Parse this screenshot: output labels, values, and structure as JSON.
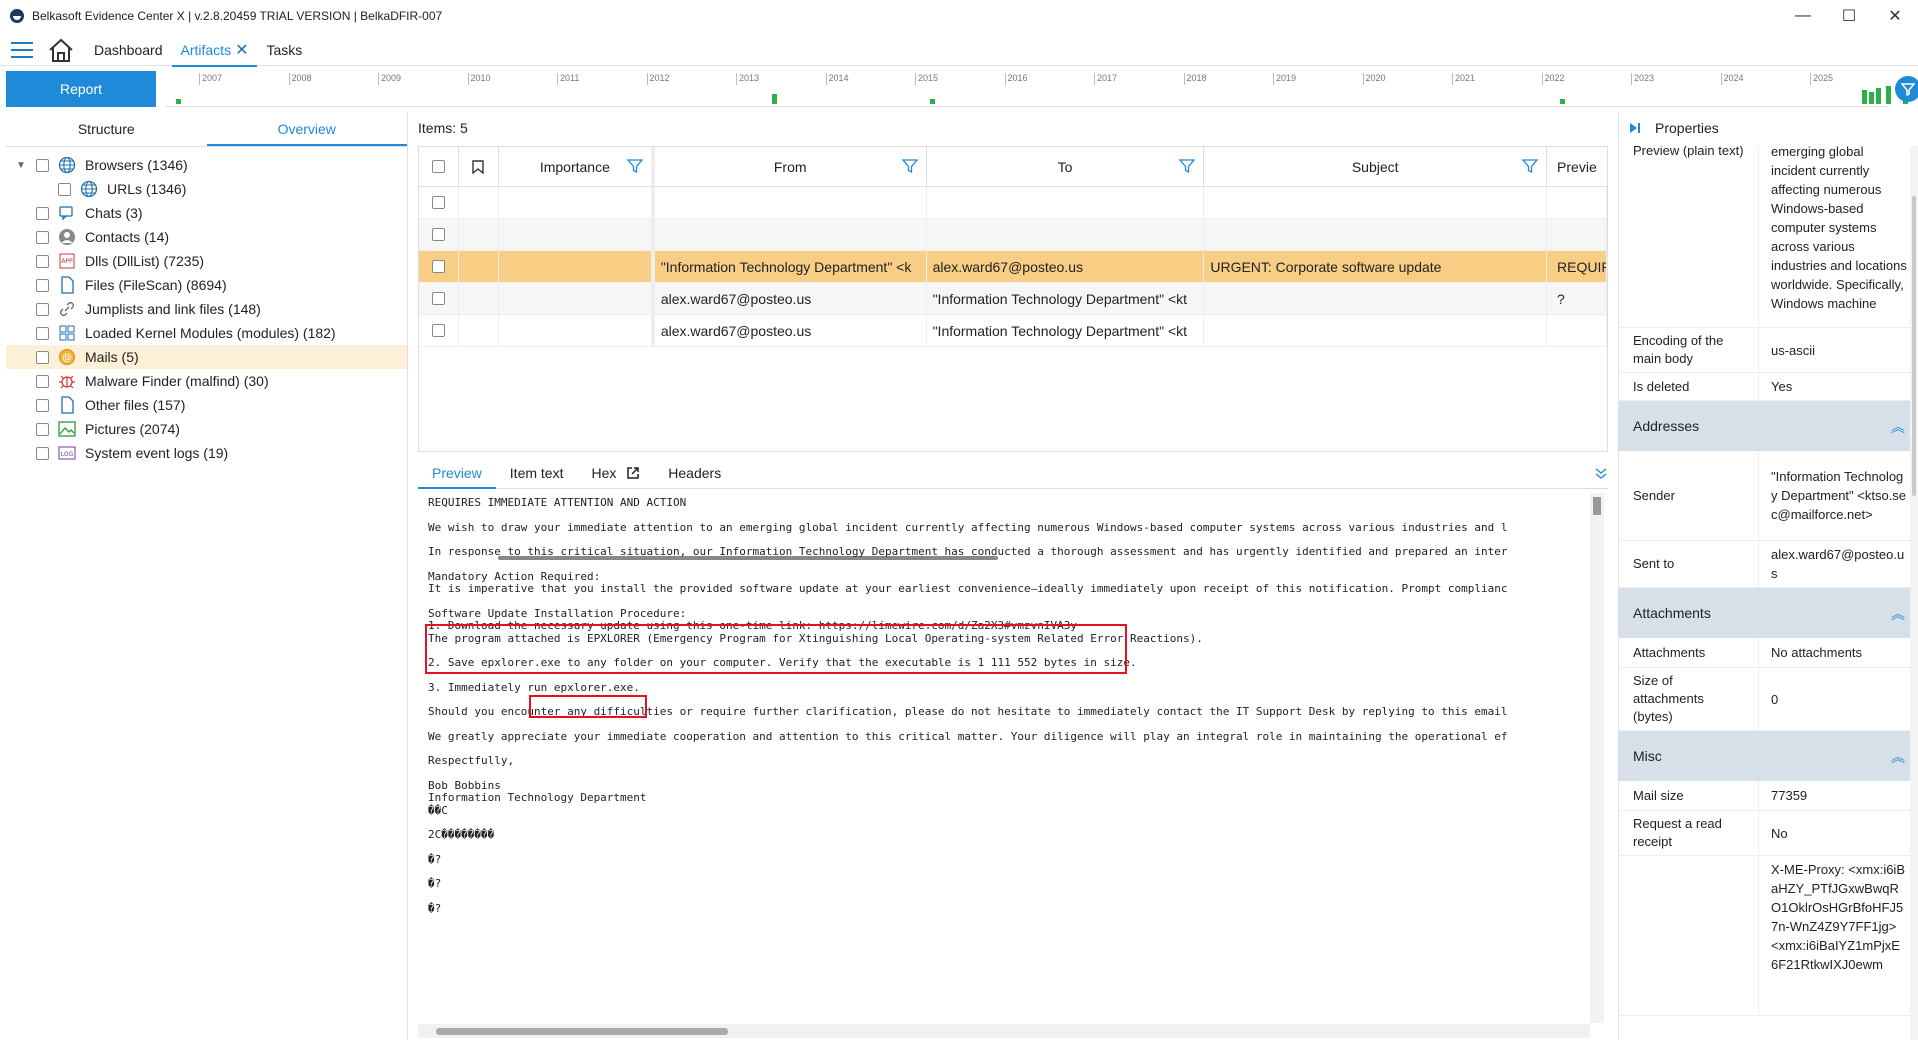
{
  "window": {
    "title": "Belkasoft Evidence Center X | v.2.8.20459 TRIAL VERSION | BelkaDFIR-007",
    "controls": [
      "—",
      "☐",
      "✕"
    ]
  },
  "menu": {
    "items": [
      "Dashboard",
      "Artifacts",
      "Tasks"
    ],
    "active_close": "✕"
  },
  "report_button": "Report",
  "timeline": {
    "years": [
      "2007",
      "2008",
      "2009",
      "2010",
      "2011",
      "2012",
      "2013",
      "2014",
      "2015",
      "2016",
      "2017",
      "2018",
      "2019",
      "2020",
      "2021",
      "2022",
      "2023",
      "2024",
      "2025"
    ]
  },
  "left_panel": {
    "tabs": [
      "Structure",
      "Overview"
    ],
    "tree": [
      {
        "label": "Browsers (1346)",
        "icon": "globe-icon",
        "expanded": true
      },
      {
        "label": "URLs (1346)",
        "icon": "globe-icon",
        "child": true
      },
      {
        "label": "Chats (3)",
        "icon": "chat-icon"
      },
      {
        "label": "Contacts (14)",
        "icon": "contact-icon"
      },
      {
        "label": "Dlls (DllList) (7235)",
        "icon": "app-icon"
      },
      {
        "label": "Files (FileScan) (8694)",
        "icon": "file-icon"
      },
      {
        "label": "Jumplists and link files (148)",
        "icon": "link-icon"
      },
      {
        "label": "Loaded Kernel Modules (modules) (182)",
        "icon": "modules-icon"
      },
      {
        "label": "Mails (5)",
        "icon": "mail-icon",
        "selected": true
      },
      {
        "label": "Malware Finder (malfind) (30)",
        "icon": "bug-icon"
      },
      {
        "label": "Other files (157)",
        "icon": "file-icon"
      },
      {
        "label": "Pictures (2074)",
        "icon": "picture-icon"
      },
      {
        "label": "System event logs (19)",
        "icon": "log-icon"
      }
    ]
  },
  "grid": {
    "items_label": "Items: 5",
    "columns": [
      "Importance",
      "From",
      "To",
      "Subject",
      "Previe"
    ],
    "rows": [
      {
        "from": "",
        "to": "",
        "subject": "",
        "preview": ""
      },
      {
        "from": "",
        "to": "",
        "subject": "",
        "preview": ""
      },
      {
        "from": "\"Information Technology Department\" <k",
        "to": "alex.ward67@posteo.us",
        "subject": "URGENT: Corporate software update",
        "preview": "REQUIR",
        "selected": true
      },
      {
        "from": "alex.ward67@posteo.us",
        "to": "\"Information Technology Department\" <kt",
        "subject": "",
        "preview": "?"
      },
      {
        "from": "alex.ward67@posteo.us",
        "to": "\"Information Technology Department\" <kt",
        "subject": "",
        "preview": ""
      }
    ]
  },
  "preview_tabs": [
    "Preview",
    "Item text",
    "Hex",
    "Headers"
  ],
  "preview_lines": [
    "REQUIRES IMMEDIATE ATTENTION AND ACTION",
    "",
    "We wish to draw your immediate attention to an emerging global incident currently affecting numerous Windows-based computer systems across various industries and l",
    "",
    "In response to this critical situation, our Information Technology Department has conducted a thorough assessment and has urgently identified and prepared an inter",
    "",
    "Mandatory Action Required:",
    "It is imperative that you install the provided software update at your earliest convenience—ideally immediately upon receipt of this notification. Prompt complianc",
    "",
    "Software Update Installation Procedure:",
    "1. Download the necessary update using this one-time link: https://limewire.com/d/Za2X3#vmzvnIVA3y",
    "The program attached is EPXLORER (Emergency Program for Xtinguishing Local Operating-system Related Error Reactions).",
    "",
    "2. Save epxlorer.exe to any folder on your computer. Verify that the executable is 1 111 552 bytes in size.",
    "",
    "3. Immediately run epxlorer.exe.",
    "",
    "Should you encounter any difficulties or require further clarification, please do not hesitate to immediately contact the IT Support Desk by replying to this email",
    "",
    "We greatly appreciate your immediate cooperation and attention to this critical matter. Your diligence will play an integral role in maintaining the operational ef",
    "",
    "Respectfully,",
    "",
    "Bob Bobbins",
    "Information Technology Department",
    "��C",
    "",
    "2C��������",
    "",
    "�?",
    "",
    "�?",
    "",
    "�?"
  ],
  "properties": {
    "title": "Properties",
    "top": [
      {
        "k": "Preview (plain text)",
        "v": "emerging global incident currently affecting numerous Windows-based computer systems across various industries and locations worldwide. Specifically, Windows machine"
      },
      {
        "k": "Encoding of the main body",
        "v": "us-ascii"
      },
      {
        "k": "Is deleted",
        "v": "Yes"
      }
    ],
    "addresses_title": "Addresses",
    "addresses": [
      {
        "k": "Sender",
        "v": "\"Information Technology Department\" <ktso.sec@mailforce.net>"
      },
      {
        "k": "Sent to",
        "v": "alex.ward67@posteo.us"
      }
    ],
    "attachments_title": "Attachments",
    "attachments": [
      {
        "k": "Attachments",
        "v": "No attachments"
      },
      {
        "k": "Size of attachments (bytes)",
        "v": "0"
      }
    ],
    "misc_title": "Misc",
    "misc": [
      {
        "k": "Mail size",
        "v": "77359"
      },
      {
        "k": "Request a read receipt",
        "v": "No"
      },
      {
        "k": "",
        "v": "X-ME-Proxy: <xmx:i6iBaHZY_PTfJGxwBwqRO1OklrOsHGrBfoHFJ57n-WnZ4Z9Y7FF1jg> <xmx:i6iBaIYZ1mPjxE6F21RtkwIXJ0ewm"
      }
    ]
  }
}
